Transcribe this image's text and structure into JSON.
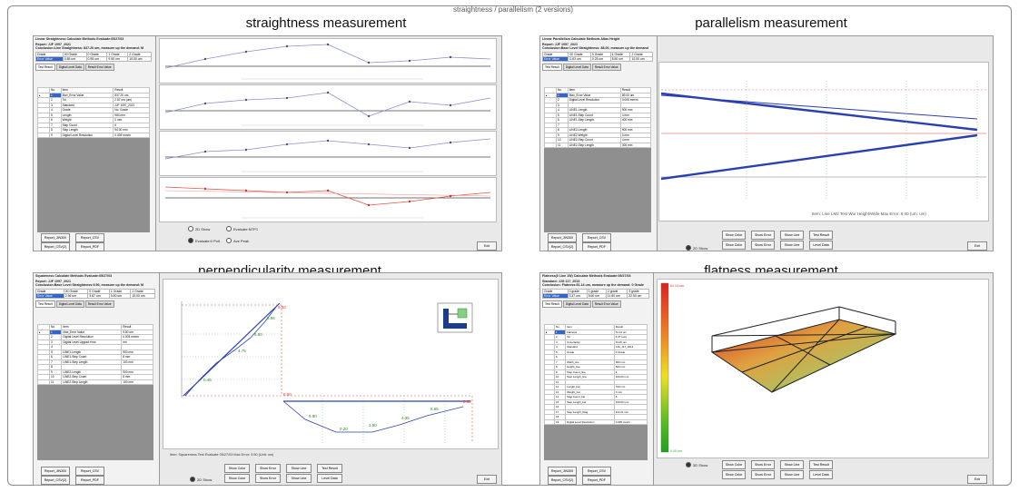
{
  "top_caption": "straightness / parallelism (2 versions)",
  "titles": {
    "straightness": "straightness measurement",
    "parallelism": "parallelism measurement",
    "perpendicularity": "perpendicularity measurement",
    "flatness": "flatness measurement"
  },
  "panels": {
    "straightness": {
      "header": [
        "Linear Straightness  Calculate Methods  Evaluate:05/27/03",
        "Report: JJF 1097_2021",
        "Conclusion:Line Straightness: 837.20 um, measure up the demand: M"
      ],
      "grade_headers": [
        "Grade",
        "00 Grade",
        "0 Grade",
        "1 Grade",
        "2 Grade"
      ],
      "grade_values": [
        "Error Value",
        "0.85 um",
        "0.95 um",
        "9.90 um",
        "10.00 um"
      ],
      "tabs": [
        "Test Result",
        "Digital Level Data",
        "Result Error Value"
      ],
      "grid_headers": [
        "No.",
        "Item",
        "Result"
      ],
      "grid_rows": [
        [
          "1",
          "Max_Error Value",
          "837.20 um"
        ],
        [
          "2",
          "Tol",
          "2.87 um (um)"
        ],
        [
          "3",
          "Standard",
          "JJF 1097_2021"
        ],
        [
          "4",
          "Grade",
          "No. Grade"
        ],
        [
          "5",
          "Length",
          "984 mm"
        ],
        [
          "6",
          "Weight",
          "0 mm"
        ],
        [
          "7",
          "Step Count",
          "6"
        ],
        [
          "8",
          "Step Length",
          "94.00 mm"
        ],
        [
          "9",
          "Digital Level Resolution",
          "0.005 mm/m"
        ]
      ],
      "buttons": [
        "Report_JIN300",
        "Report_CSV",
        "Report_CSV(2)",
        "Report_PDF"
      ],
      "radios": [
        "2D Show",
        "Evaluate:0 Polt",
        "Evaluate M7P1",
        "Ave Peak"
      ],
      "exit": "Exit"
    },
    "parallelism": {
      "header": [
        "Linear Parallelism  Calculate Methods  Atlas Height",
        "Report: JJF 1097_2021",
        "Conclusion:Base Level Straightness: 88.00, measure up the demand"
      ],
      "grade_headers": [
        "Grade",
        "00 Grade",
        "0 Grade",
        "1 Grade",
        "2 Grade"
      ],
      "grade_values": [
        "Error Value",
        "0.63 um",
        "0.25 um",
        "8.50 um",
        "10.00 um"
      ],
      "tabs": [
        "Test Result",
        "Digital Level Data",
        "Result Error Value"
      ],
      "grid_headers": [
        "No.",
        "Item",
        "Result"
      ],
      "grid_rows": [
        [
          "1",
          "Max_Error Value",
          "89.00 um"
        ],
        [
          "2",
          "Digital Level Resolution",
          "0.005 mm/m"
        ],
        [
          "3",
          "",
          " "
        ],
        [
          "4",
          "LINE1-Length",
          "900 mm"
        ],
        [
          "5",
          "LINE1-Step Count",
          "4 mm"
        ],
        [
          "6",
          "LINE1-Step Length",
          "400 mm"
        ],
        [
          "7",
          "",
          ""
        ],
        [
          "8",
          "LINE2-Length",
          "900 mm"
        ],
        [
          "9",
          "LINE2-Weight",
          "0 mm"
        ],
        [
          "10",
          "LINE2-Step Count",
          "4 mm"
        ],
        [
          "11",
          "LINE2-Step Length",
          "300 mm"
        ]
      ],
      "buttons": [
        "Report_JIN300",
        "Report_CSV",
        "Report_CSV(2)",
        "Report_PDF"
      ],
      "actions": [
        "Show Color",
        "Show Error",
        "Show Line",
        "Test Result",
        "Show Color",
        "Show Error",
        "Show Line",
        "Level Data"
      ],
      "radio": "2D Show",
      "footer_text": "Item: Line LM2 Test   Wor Height/Wide   Max Error: 8.00 (um: um)",
      "exit": "Exit"
    },
    "perpendicularity": {
      "header": [
        "Squareness  Calculate Methods  Evaluate:05/27/03",
        "Report: JJF 1097_2021",
        "Conclusion:Base Level Straightness:9.50, measure up the demand: M"
      ],
      "grade_headers": [
        "Grade",
        "00 Grade",
        "0 Grade",
        "1 Grade",
        "2 Grade"
      ],
      "grade_values": [
        "Error Value",
        "2.56 um",
        "3.87 um",
        "5.80 um",
        "15.00 um"
      ],
      "tabs": [
        "Test Result",
        "Digital Level Data",
        "Result Error Value"
      ],
      "grid_headers": [
        "No.",
        "Item",
        "Result"
      ],
      "grid_rows": [
        [
          "1",
          "Max_Error Value",
          "9.50 um"
        ],
        [
          "2",
          "Digital Level Resolution",
          "0.005 mm/m"
        ],
        [
          "3",
          "Digital Level Upgrad error",
          "nm"
        ],
        [
          "4",
          "",
          ""
        ],
        [
          "5",
          "LINE1-Length",
          "900 mm"
        ],
        [
          "6",
          "LINE1-Step Count",
          "8 mm"
        ],
        [
          "7",
          "LINE1-Step Length",
          "100 mm"
        ],
        [
          "8",
          "",
          ""
        ],
        [
          "9",
          "LINE2-Length",
          "900 mm"
        ],
        [
          "10",
          "LINE2-Step Count",
          "8 mm"
        ],
        [
          "11",
          "LINE2-Step Length",
          "100 mm"
        ]
      ],
      "buttons": [
        "Report_JIN300",
        "Report_CSV",
        "Report_CSV(2)",
        "Report_PDF"
      ],
      "actions": [
        "Show Color",
        "Show Error",
        "Show Line",
        "Test Result",
        "Show Color",
        "Show Error",
        "Show Line",
        "Level Data"
      ],
      "radio": "2D Show",
      "footer_text": "Item:  Squareness Test     Evaluate 05/27/03      Max Error: 9.50   (Unit: um)",
      "exit": "Exit",
      "vertical_labels": [
        "0.45",
        "4.75",
        "5.80",
        "8.96",
        "9.50"
      ],
      "horizontal_labels": [
        "8.50",
        "6.90",
        "0.20",
        "3.90",
        "4.35",
        "6.65",
        "8.50"
      ]
    },
    "flatness": {
      "header": [
        "Flatness(0 Line 1W)  Calculate Methods  Evaluate:05/27/03",
        "Standard: JJG 117_2013",
        "Conclusion: Flatness:51.14 um, measure up the demand: 0 Grade"
      ],
      "grade_headers": [
        "Grade",
        "0 grade",
        "1 grade",
        "2 grade",
        "3 grade"
      ],
      "grade_values": [
        "Error Value",
        "3.37 um",
        "5.60 um",
        "11.80 um",
        "22.50 um"
      ],
      "tabs": [
        "Test Result",
        "Digital Level Data",
        "Result Error Value"
      ],
      "grid_headers": [
        "No.",
        "Item",
        "Result"
      ],
      "grid_rows": [
        [
          "1",
          "Flatness",
          "51.14 um"
        ],
        [
          "2",
          "Tol",
          "6.27 (um)"
        ],
        [
          "3",
          "Uncertainty",
          "43.20 um"
        ],
        [
          "4",
          "Standard",
          "JJG_117_2013"
        ],
        [
          "5",
          "Grade",
          "0 Grade"
        ],
        [
          "6",
          "",
          ""
        ],
        [
          "7",
          "Width_line",
          "600 mm"
        ],
        [
          "8",
          "Height_line",
          "500 mm"
        ],
        [
          "9",
          "Step Count_line",
          "4"
        ],
        [
          "10",
          "Step Length_line",
          "100.00 mm"
        ],
        [
          "11",
          "",
          ""
        ],
        [
          "12",
          "Length_bar",
          "700 mm"
        ],
        [
          "13",
          "Weight_bar",
          "0 mm"
        ],
        [
          "14",
          "Step Count_bar",
          "8"
        ],
        [
          "15",
          "Step Length_bar",
          "100.00 mm"
        ],
        [
          "16",
          "",
          ""
        ],
        [
          "17",
          "Step Length_Diag",
          "113.21 mm"
        ],
        [
          "18",
          "",
          ""
        ],
        [
          "19",
          "Digital Level Resolution",
          "0.005 mm/m"
        ]
      ],
      "buttons": [
        "Report_JIN300",
        "Report_CSV",
        "Report_CSV(2)",
        "Report_PDF"
      ],
      "actions": [
        "Show Color",
        "Show Error",
        "Show Line",
        "Test Result",
        "Show Color",
        "Show Error",
        "Show Line",
        "Level Data"
      ],
      "radio": "3D Show",
      "legend_top": "61.14 um",
      "legend_bottom": "0.00 um",
      "exit": "Exit"
    }
  },
  "colors": {
    "accent_blue": "#3a4fb3",
    "accent_red": "#d33",
    "accent_green": "#2a8a2a"
  }
}
